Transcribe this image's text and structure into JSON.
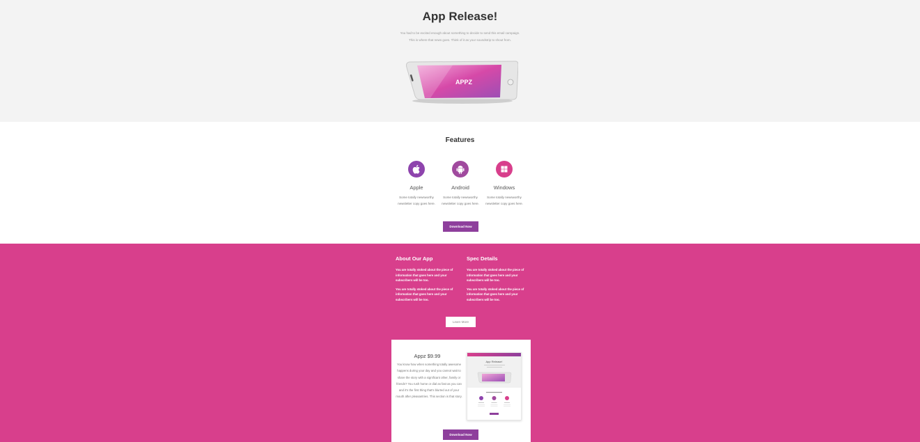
{
  "hero": {
    "title": "App Release!",
    "text_line1": "You had to be excited enough about something to decide to send this email campaign.",
    "text_line2": "This is where that news goes. Think of it as your soundstrip to shout from.",
    "phone_label": "APPZ"
  },
  "features": {
    "title": "Features",
    "items": [
      {
        "name": "Apple",
        "desc_line1": "Some totally newsworthy",
        "desc_line2": "newsletter copy goes here.",
        "icon": "apple-icon"
      },
      {
        "name": "Android",
        "desc_line1": "Some totally newsworthy",
        "desc_line2": "newsletter copy goes here.",
        "icon": "android-icon"
      },
      {
        "name": "Windows",
        "desc_line1": "Some totally newsworthy",
        "desc_line2": "newsletter copy goes here.",
        "icon": "windows-icon"
      }
    ],
    "button_label": "Download Now"
  },
  "about": {
    "col1": {
      "heading": "About Our App",
      "p1": "You are totally stoked about the piece of information that goes here and your subscribers will be too.",
      "p2": "You are totally stoked about the piece of information that goes here and your subscribers will be too."
    },
    "col2": {
      "heading": "Spec Details",
      "p1": "You are totally stoked about the piece of information that goes here and your subscribers will be too.",
      "p2": "You are totally stoked about the piece of information that goes here and your subscribers will be too."
    },
    "learn_label": "Learn More"
  },
  "product": {
    "title": "Appz $9.99",
    "text": "You know how when something totally awesome happens during your day and you cannot wait to share the story with a significant other, family or friends? You rush home or dial as fast as you can and it's the first thing that's blurted out of your mouth after pleasantries. This section is that story.",
    "thumb_title": "App Release!",
    "button_label": "Download Now"
  },
  "colors": {
    "pink": "#d83f8c",
    "purple": "#8e3f9c",
    "hero_bg": "#f3f3f3"
  }
}
